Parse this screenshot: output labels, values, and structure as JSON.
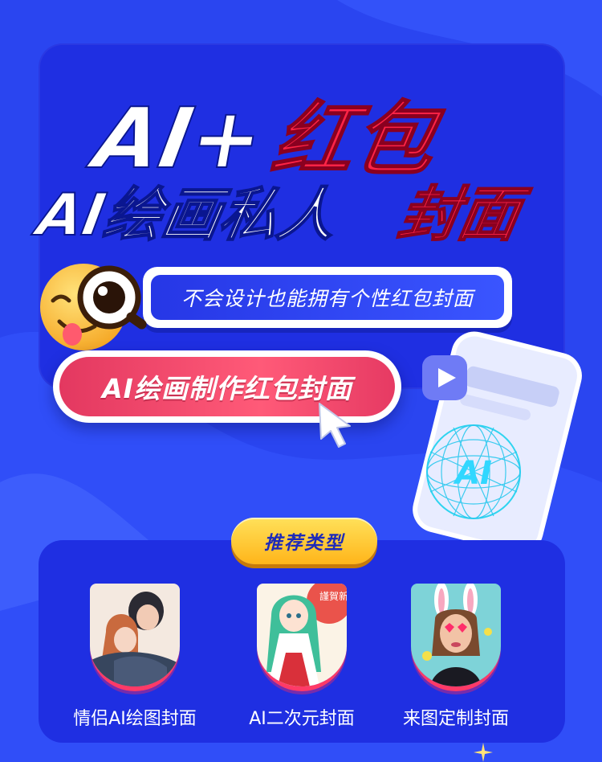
{
  "title": {
    "line1_white": "AI+",
    "line1_red": "红包",
    "line2_white": "AI绘画私人",
    "line2_red": "封面"
  },
  "slogan": "不会设计也能拥有个性红包封面",
  "cta": {
    "label": "AI绘画制作红包封面"
  },
  "phone": {
    "ai_text": "AI"
  },
  "recommend": {
    "badge": "推荐类型",
    "items": [
      {
        "label": "情侣AI绘图封面",
        "icon": "couple-illustration"
      },
      {
        "label": "AI二次元封面",
        "icon": "anime-girl-illustration",
        "stamp": "謹賀新"
      },
      {
        "label": "来图定制封面",
        "icon": "bunny-ears-photo"
      }
    ]
  },
  "colors": {
    "background": "#2a45f0",
    "panel": "#1f2fe2",
    "accent_red": "#ff2a55",
    "badge_yellow": "#ffc53a"
  }
}
